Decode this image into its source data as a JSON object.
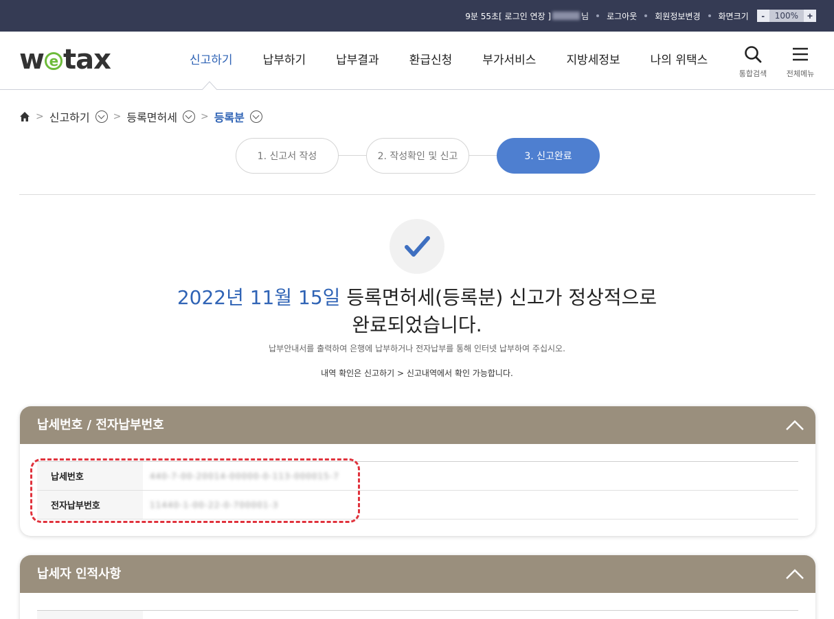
{
  "topbar": {
    "session_text": "9분 55초[ 로그인 연장 ]",
    "user_suffix": "님",
    "logout": "로그아웃",
    "member_edit": "회원정보변경",
    "screen_size_label": "화면크기",
    "zoom_minus": "-",
    "zoom_value": "100%",
    "zoom_plus": "+"
  },
  "header": {
    "logo_left": "w",
    "logo_mid": "e",
    "logo_right": "tax",
    "nav": [
      "신고하기",
      "납부하기",
      "납부결과",
      "환급신청",
      "부가서비스",
      "지방세정보",
      "나의 위택스"
    ],
    "search_label": "통합검색",
    "menu_label": "전체메뉴"
  },
  "breadcrumb": {
    "items": [
      "신고하기",
      "등록면허세",
      "등록분"
    ]
  },
  "steps": [
    "1. 신고서 작성",
    "2. 작성확인 및 신고",
    "3. 신고완료"
  ],
  "completion": {
    "date": "2022년 11월 15일",
    "line1_rest": " 등록면허세(등록분) 신고가 정상적으로",
    "line2": "완료되었습니다.",
    "sub1": "납부안내서를 출력하여 은행에 납부하거나 전자납부를 통해 인터넷 납부하여 주십시오.",
    "sub2": "내역 확인은 신고하기 > 신고내역에서 확인 가능합니다."
  },
  "panel1": {
    "title": "납세번호 / 전자납부번호",
    "rows": [
      {
        "label": "납세번호",
        "value": "440-7-00-20014-00000-0-113-000015-7"
      },
      {
        "label": "전자납부번호",
        "value": "11440-1-00-22-0-700001-3"
      }
    ]
  },
  "panel2": {
    "title": "납세자 인적사항"
  },
  "colors": {
    "topbar": "#353b54",
    "accent": "#2f63b5",
    "step_active": "#4e7fd0",
    "panel_header": "#9a8f7d",
    "highlight": "#e0323c"
  }
}
